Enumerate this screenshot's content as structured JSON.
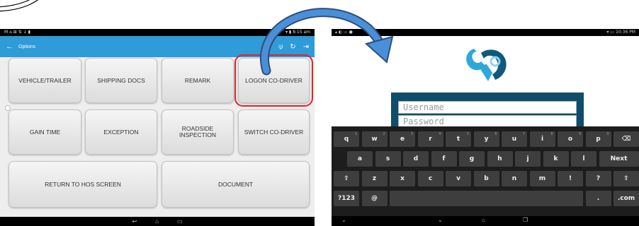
{
  "left_screen": {
    "status_bar": {
      "left": "M ⌂ ⊞ ⇅ ↓ ▮",
      "right": "▾ ▮ 8:15 am"
    },
    "app_bar": {
      "back_icon": "arrow-left-icon",
      "title": "Options",
      "actions": [
        "signal-icon",
        "refresh-icon",
        "logout-icon"
      ]
    },
    "buttons": {
      "vehicle_trailer": "VEHICLE/TRAILER",
      "shipping_docs": "SHIPPING DOCS",
      "remark": "REMARK",
      "logon_co_driver": "LOGON CO-DRIVER",
      "gain_time": "GAIN TIME",
      "exception": "EXCEPTION",
      "roadside_inspection": "ROADSIDE\nINSPECTION",
      "switch_co_driver": "SWITCH CO-DRIVER",
      "return_to_hos": "RETURN TO HOS SCREEN",
      "document": "DOCUMENT"
    },
    "highlight_color": "#e0232b"
  },
  "right_screen": {
    "status_bar": {
      "left": "▴ ◐ ▭ ●",
      "right": "▾ ▭ 10:36 PM"
    },
    "login": {
      "username_placeholder": "Username",
      "password_placeholder": "Password"
    },
    "keyboard": {
      "row1": [
        {
          "k": "q",
          "h": "1"
        },
        {
          "k": "w",
          "h": "2"
        },
        {
          "k": "e",
          "h": "3"
        },
        {
          "k": "r",
          "h": "4"
        },
        {
          "k": "t",
          "h": "5"
        },
        {
          "k": "y",
          "h": "6"
        },
        {
          "k": "u",
          "h": "7"
        },
        {
          "k": "i",
          "h": "8"
        },
        {
          "k": "o",
          "h": "9"
        },
        {
          "k": "p",
          "h": "0"
        },
        {
          "k": "⌫",
          "h": ""
        }
      ],
      "row2": [
        "a",
        "s",
        "d",
        "f",
        "g",
        "h",
        "j",
        "k",
        "l",
        "Next"
      ],
      "row3": [
        "⇧",
        "z",
        "x",
        "c",
        "v",
        "b",
        "n",
        "m",
        "!",
        "?",
        "⇧"
      ],
      "row4": {
        "sym": "?123",
        "at": "@",
        "space": "",
        "dot": ".",
        "com": ".com"
      }
    }
  }
}
